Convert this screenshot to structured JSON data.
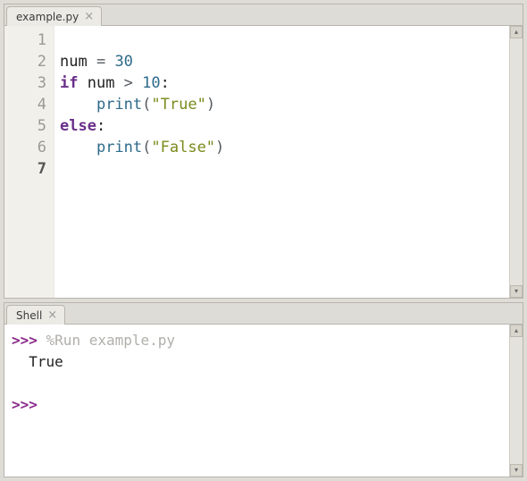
{
  "editor": {
    "tab_label": "example.py",
    "line_numbers": [
      "1",
      "2",
      "3",
      "4",
      "5",
      "6",
      "7"
    ],
    "current_line_index": 6,
    "code": {
      "l1": "",
      "l2": {
        "var": "num",
        "eq": " = ",
        "val": "30"
      },
      "l3": {
        "kw": "if",
        "mid": " num ",
        "op": ">",
        "sp": " ",
        "val": "10",
        "colon": ":"
      },
      "l4": {
        "indent": "    ",
        "fn": "print",
        "open": "(",
        "str": "\"True\"",
        "close": ")"
      },
      "l5": {
        "kw": "else",
        "colon": ":"
      },
      "l6": {
        "indent": "    ",
        "fn": "print",
        "open": "(",
        "str": "\"False\"",
        "close": ")"
      },
      "l7": ""
    }
  },
  "shell": {
    "tab_label": "Shell",
    "prompt": ">>>",
    "run_line": " %Run example.py",
    "output": "  True"
  }
}
